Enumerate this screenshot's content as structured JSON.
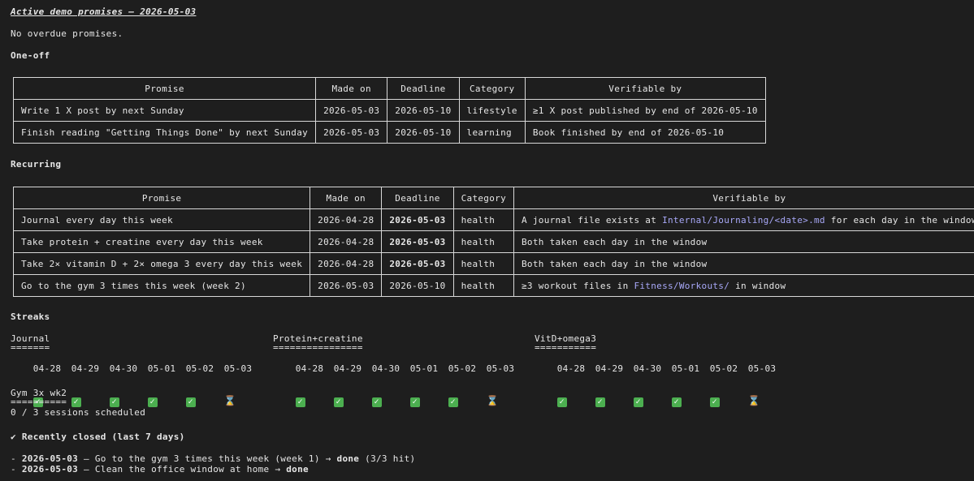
{
  "heading": "Active demo promises — 2026-05-03",
  "overdue_note": "No overdue promises.",
  "oneoff": {
    "label": "One-off",
    "headers": [
      "Promise",
      "Made on",
      "Deadline",
      "Category",
      "Verifiable by"
    ],
    "rows": [
      {
        "promise": "Write 1 X post by next Sunday",
        "made_on": "2026-05-03",
        "deadline": "2026-05-10",
        "category": "lifestyle",
        "verifiable": "≥1 X post published by end of 2026-05-10"
      },
      {
        "promise": "Finish reading \"Getting Things Done\" by next Sunday",
        "made_on": "2026-05-03",
        "deadline": "2026-05-10",
        "category": "learning",
        "verifiable": "Book finished by end of 2026-05-10"
      }
    ]
  },
  "recurring": {
    "label": "Recurring",
    "headers": [
      "Promise",
      "Made on",
      "Deadline",
      "Category",
      "Verifiable by"
    ],
    "rows": [
      {
        "promise": "Journal every day this week",
        "made_on": "2026-04-28",
        "deadline": "2026-05-03",
        "category": "health",
        "verifiable_pre": "A journal file exists at ",
        "verifiable_link": "Internal/Journaling/<date>.md",
        "verifiable_post": " for each day in the window"
      },
      {
        "promise": "Take protein + creatine every day this week",
        "made_on": "2026-04-28",
        "deadline": "2026-05-03",
        "category": "health",
        "verifiable_pre": "Both taken each day in the window",
        "verifiable_link": "",
        "verifiable_post": ""
      },
      {
        "promise": "Take 2× vitamin D + 2× omega 3 every day this week",
        "made_on": "2026-04-28",
        "deadline": "2026-05-03",
        "category": "health",
        "verifiable_pre": "Both taken each day in the window",
        "verifiable_link": "",
        "verifiable_post": ""
      },
      {
        "promise": "Go to the gym 3 times this week (week 2)",
        "made_on": "2026-05-03",
        "deadline": "2026-05-10",
        "category": "health",
        "verifiable_pre": "≥3 workout files in ",
        "verifiable_link": "Fitness/Workouts/",
        "verifiable_post": " in window"
      }
    ]
  },
  "streaks": {
    "label": "Streaks",
    "items": [
      {
        "name": "Journal",
        "underline": "=======",
        "days": [
          "04-28",
          "04-29",
          "04-30",
          "05-01",
          "05-02",
          "05-03"
        ],
        "status": [
          "done",
          "done",
          "done",
          "done",
          "done",
          "pending"
        ]
      },
      {
        "name": "Protein+creatine",
        "underline": "================",
        "days": [
          "04-28",
          "04-29",
          "04-30",
          "05-01",
          "05-02",
          "05-03"
        ],
        "status": [
          "done",
          "done",
          "done",
          "done",
          "done",
          "pending"
        ]
      },
      {
        "name": "VitD+omega3",
        "underline": "===========",
        "days": [
          "04-28",
          "04-29",
          "04-30",
          "05-01",
          "05-02",
          "05-03"
        ],
        "status": [
          "done",
          "done",
          "done",
          "done",
          "done",
          "pending"
        ]
      }
    ],
    "gym": {
      "name": "Gym 3x wk2",
      "underline": "==========",
      "sessions": "0 / 3 sessions scheduled"
    }
  },
  "recent": {
    "label": "✔ Recently closed (last 7 days)",
    "items": [
      {
        "dash": "- ",
        "date": "2026-05-03",
        "text": " — Go to the gym 3 times this week (week 1) → ",
        "result": "done",
        "extra": " (3/3 hit)"
      },
      {
        "dash": "- ",
        "date": "2026-05-03",
        "text": " — Clean the office window at home → ",
        "result": "done",
        "extra": ""
      }
    ]
  },
  "icons": {
    "done": "check-icon",
    "pending": "hourglass-icon"
  },
  "colors": {
    "background": "#1e1e1e",
    "text": "#e6e6e6",
    "link": "#a8a8f8",
    "check": "#4caf50"
  }
}
